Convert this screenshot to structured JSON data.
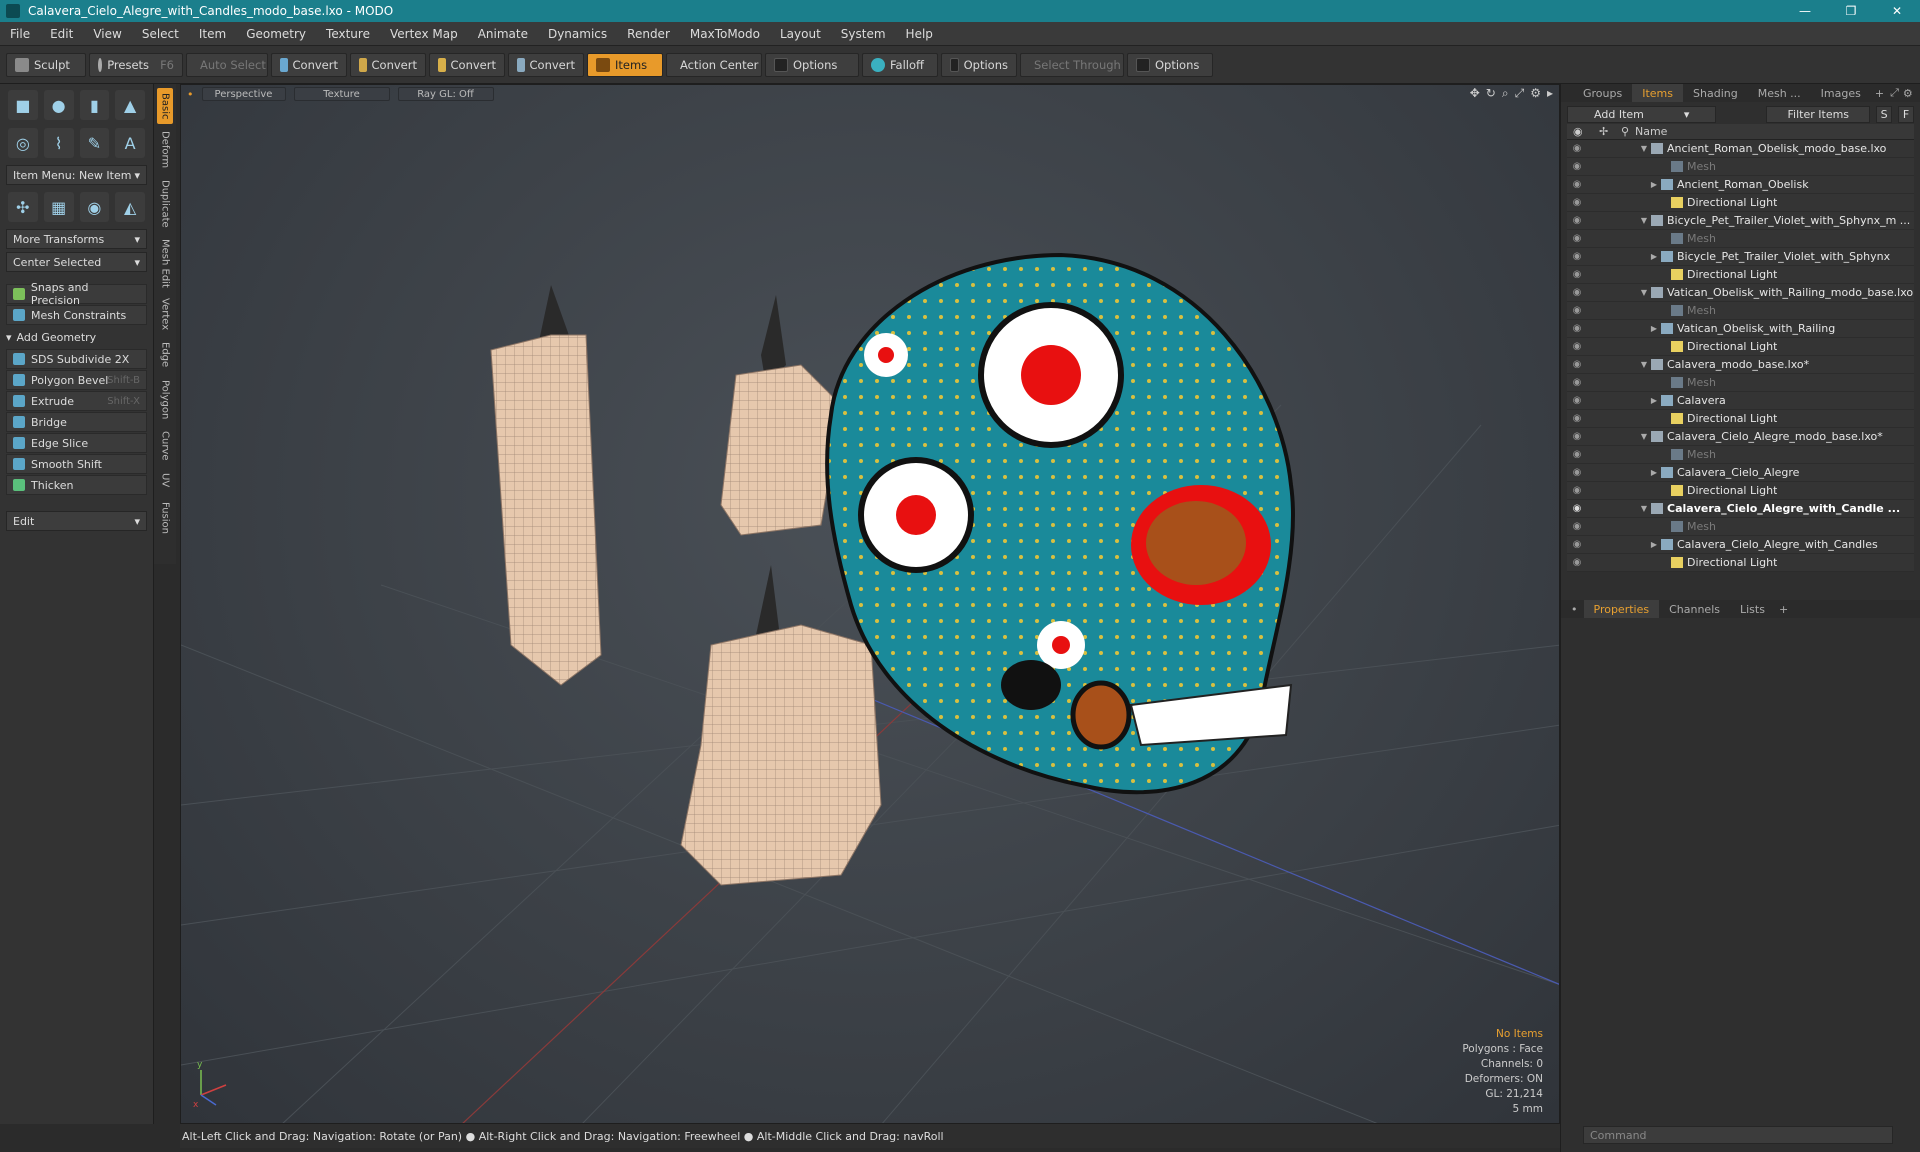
{
  "window": {
    "title": "Calavera_Cielo_Alegre_with_Candles_modo_base.lxo - MODO",
    "minimize": "—",
    "restore": "❐",
    "close": "✕"
  },
  "menu": [
    "File",
    "Edit",
    "View",
    "Select",
    "Item",
    "Geometry",
    "Texture",
    "Vertex Map",
    "Animate",
    "Dynamics",
    "Render",
    "MaxToModo",
    "Layout",
    "System",
    "Help"
  ],
  "toolbar": {
    "sculpt": "Sculpt",
    "presets": "Presets",
    "presets_key": "F6",
    "auto_select": "Auto Select",
    "convert1": "Convert",
    "convert2": "Convert",
    "convert3": "Convert",
    "convert4": "Convert",
    "items": "Items",
    "action_center": "Action Center",
    "options1": "Options",
    "falloff": "Falloff",
    "options2": "Options",
    "select_through": "Select Through",
    "options3": "Options"
  },
  "leftpanel": {
    "item_menu": "Item Menu: New Item",
    "more_transforms": "More Transforms",
    "center_selected": "Center Selected",
    "snaps": "Snaps and Precision",
    "mesh_constraints": "Mesh Constraints",
    "add_geometry": "Add Geometry",
    "tools": [
      {
        "label": "SDS Subdivide 2X",
        "shortcut": ""
      },
      {
        "label": "Polygon Bevel",
        "shortcut": "Shift-B"
      },
      {
        "label": "Extrude",
        "shortcut": "Shift-X"
      },
      {
        "label": "Bridge",
        "shortcut": ""
      },
      {
        "label": "Edge Slice",
        "shortcut": ""
      },
      {
        "label": "Smooth Shift",
        "shortcut": ""
      },
      {
        "label": "Thicken",
        "shortcut": ""
      }
    ],
    "edit": "Edit"
  },
  "vtabs": [
    "Basic",
    "Deform",
    "Duplicate",
    "Mesh Edit",
    "Vertex",
    "Edge",
    "Polygon",
    "Curve",
    "UV",
    "Fusion"
  ],
  "viewport": {
    "view": "Perspective",
    "shading": "Texture",
    "raygl": "Ray GL: Off",
    "stats": {
      "no_items": "No Items",
      "polygons": "Polygons : Face",
      "channels": "Channels: 0",
      "deformers": "Deformers: ON",
      "gl": "GL: 21,214",
      "scale": "5 mm"
    },
    "axis": {
      "x": "x",
      "y": "y"
    }
  },
  "statusbar": "Alt-Left Click and Drag: Navigation: Rotate (or Pan) ● Alt-Right Click and Drag: Navigation: Freewheel ● Alt-Middle Click and Drag: navRoll",
  "rightpanel": {
    "tabs": [
      "Groups",
      "Items",
      "Shading",
      "Mesh ...",
      "Images"
    ],
    "add_item": "Add Item",
    "filter_items": "Filter Items",
    "s_btn": "S",
    "f_btn": "F",
    "name_col": "Name",
    "tree": [
      {
        "label": "Ancient_Roman_Obelisk_modo_base.lxo",
        "level": 0,
        "type": "scene",
        "arrow": "▼"
      },
      {
        "label": "Mesh",
        "level": 2,
        "type": "mesh",
        "dim": true
      },
      {
        "label": "Ancient_Roman_Obelisk",
        "level": 1,
        "type": "item",
        "arrow": "▶"
      },
      {
        "label": "Directional Light",
        "level": 2,
        "type": "light"
      },
      {
        "label": "Bicycle_Pet_Trailer_Violet_with_Sphynx_m ...",
        "level": 0,
        "type": "scene",
        "arrow": "▼"
      },
      {
        "label": "Mesh",
        "level": 2,
        "type": "mesh",
        "dim": true
      },
      {
        "label": "Bicycle_Pet_Trailer_Violet_with_Sphynx",
        "level": 1,
        "type": "item",
        "arrow": "▶"
      },
      {
        "label": "Directional Light",
        "level": 2,
        "type": "light"
      },
      {
        "label": "Vatican_Obelisk_with_Railing_modo_base.lxo",
        "level": 0,
        "type": "scene",
        "arrow": "▼"
      },
      {
        "label": "Mesh",
        "level": 2,
        "type": "mesh",
        "dim": true
      },
      {
        "label": "Vatican_Obelisk_with_Railing",
        "level": 1,
        "type": "item",
        "arrow": "▶"
      },
      {
        "label": "Directional Light",
        "level": 2,
        "type": "light"
      },
      {
        "label": "Calavera_modo_base.lxo*",
        "level": 0,
        "type": "scene",
        "arrow": "▼"
      },
      {
        "label": "Mesh",
        "level": 2,
        "type": "mesh",
        "dim": true
      },
      {
        "label": "Calavera",
        "level": 1,
        "type": "item",
        "arrow": "▶"
      },
      {
        "label": "Directional Light",
        "level": 2,
        "type": "light"
      },
      {
        "label": "Calavera_Cielo_Alegre_modo_base.lxo*",
        "level": 0,
        "type": "scene",
        "arrow": "▼"
      },
      {
        "label": "Mesh",
        "level": 2,
        "type": "mesh",
        "dim": true
      },
      {
        "label": "Calavera_Cielo_Alegre",
        "level": 1,
        "type": "item",
        "arrow": "▶"
      },
      {
        "label": "Directional Light",
        "level": 2,
        "type": "light"
      },
      {
        "label": "Calavera_Cielo_Alegre_with_Candle ...",
        "level": 0,
        "type": "scene",
        "arrow": "▼",
        "bold": true
      },
      {
        "label": "Mesh",
        "level": 2,
        "type": "mesh",
        "dim": true
      },
      {
        "label": "Calavera_Cielo_Alegre_with_Candles",
        "level": 1,
        "type": "item",
        "arrow": "▶"
      },
      {
        "label": "Directional Light",
        "level": 2,
        "type": "light"
      }
    ],
    "prop_tabs": [
      "Properties",
      "Channels",
      "Lists"
    ],
    "command_placeholder": "Command"
  },
  "colors": {
    "accent": "#e89a2a",
    "title_bar": "#1b7f8c",
    "skull": "#1a8a9a"
  }
}
